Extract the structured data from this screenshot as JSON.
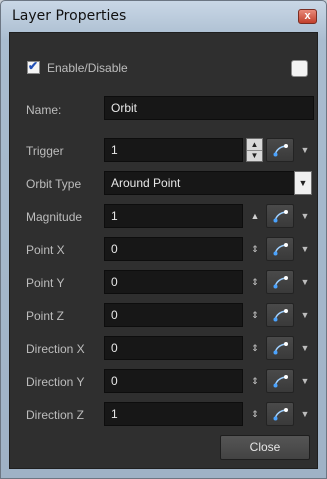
{
  "window": {
    "title": "Layer Properties",
    "close_glyph": "x"
  },
  "enable": {
    "label": "Enable/Disable",
    "checked": true
  },
  "extra_checkbox": {
    "checked": false
  },
  "fields": {
    "name": {
      "label": "Name:",
      "value": "Orbit"
    },
    "trigger": {
      "label": "Trigger",
      "value": "1"
    },
    "orbit_type": {
      "label": "Orbit Type",
      "value": "Around Point"
    },
    "magnitude": {
      "label": "Magnitude",
      "value": "1"
    },
    "point_x": {
      "label": "Point X",
      "value": "0"
    },
    "point_y": {
      "label": "Point Y",
      "value": "0"
    },
    "point_z": {
      "label": "Point Z",
      "value": "0"
    },
    "direction_x": {
      "label": "Direction X",
      "value": "0"
    },
    "direction_y": {
      "label": "Direction Y",
      "value": "0"
    },
    "direction_z": {
      "label": "Direction Z",
      "value": "1"
    }
  },
  "footer": {
    "close_label": "Close"
  },
  "icons": {
    "checkmark": "checkmark-icon",
    "link": "link-curve-icon",
    "dropdown": "chevron-down-icon",
    "spinner": "spinner-icon"
  },
  "colors": {
    "panel_bg": "#2f2f2f",
    "field_bg": "#171717",
    "link_dot_a": "#4aa3ff",
    "link_dot_b": "#ffffff"
  }
}
